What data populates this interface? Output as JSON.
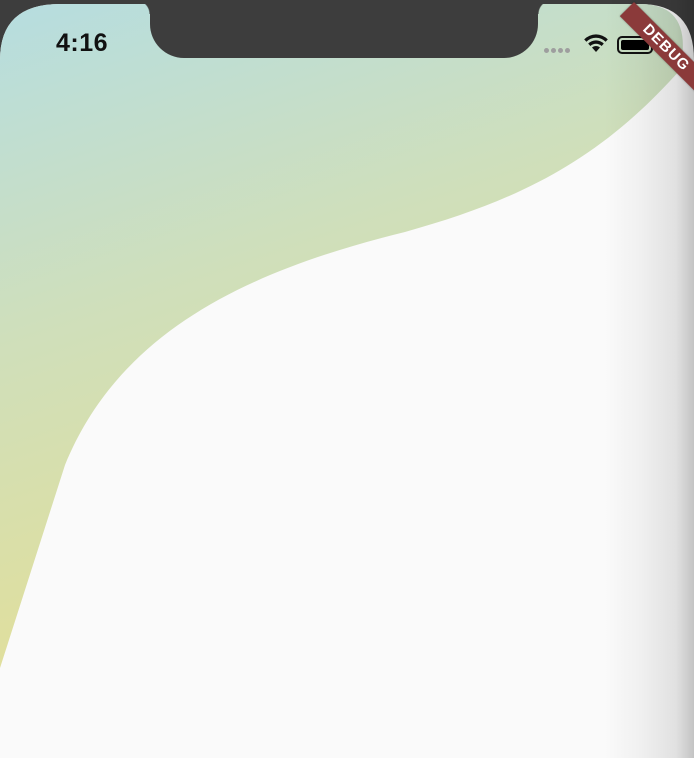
{
  "status_bar": {
    "time": "4:16",
    "signal_icon": "cellular-signal-icon",
    "wifi_icon": "wifi-icon",
    "battery_icon": "battery-icon",
    "battery_level": 1.0
  },
  "debug_banner": {
    "label": "DEBUG",
    "color": "#8b3a3a"
  },
  "header": {
    "gradient_colors": [
      "#b6dde0",
      "#cfdfb8",
      "#e2df98"
    ]
  },
  "body": {
    "background_color": "#fafafa"
  }
}
